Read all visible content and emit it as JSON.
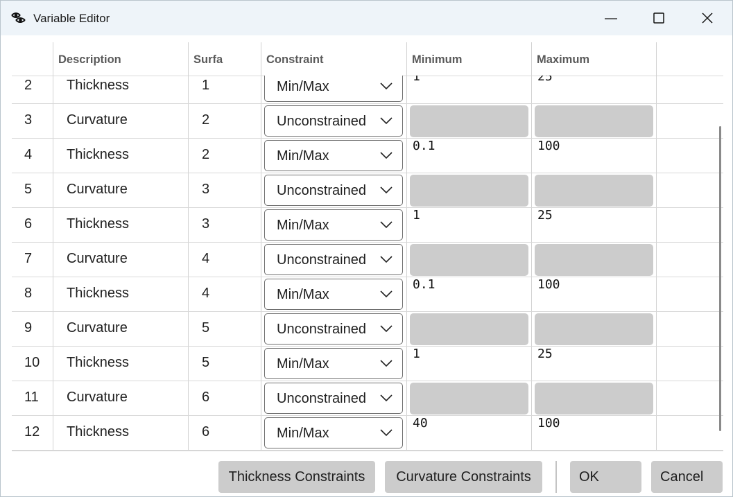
{
  "window": {
    "title": "Variable Editor",
    "controls": {
      "minimize": "minimize-icon",
      "maximize": "maximize-icon",
      "close": "close-icon"
    }
  },
  "table": {
    "columns": [
      "",
      "Description",
      "Surfa",
      "Constraint",
      "Minimum",
      "Maximum"
    ],
    "rows": [
      {
        "num": "2",
        "description": "Thickness",
        "surface": "1",
        "constraint": "Min/Max",
        "min": "1",
        "max": "25",
        "disabled": false
      },
      {
        "num": "3",
        "description": "Curvature",
        "surface": "2",
        "constraint": "Unconstrained",
        "min": "",
        "max": "",
        "disabled": true
      },
      {
        "num": "4",
        "description": "Thickness",
        "surface": "2",
        "constraint": "Min/Max",
        "min": "0.1",
        "max": "100",
        "disabled": false
      },
      {
        "num": "5",
        "description": "Curvature",
        "surface": "3",
        "constraint": "Unconstrained",
        "min": "",
        "max": "",
        "disabled": true
      },
      {
        "num": "6",
        "description": "Thickness",
        "surface": "3",
        "constraint": "Min/Max",
        "min": "1",
        "max": "25",
        "disabled": false
      },
      {
        "num": "7",
        "description": "Curvature",
        "surface": "4",
        "constraint": "Unconstrained",
        "min": "",
        "max": "",
        "disabled": true
      },
      {
        "num": "8",
        "description": "Thickness",
        "surface": "4",
        "constraint": "Min/Max",
        "min": "0.1",
        "max": "100",
        "disabled": false
      },
      {
        "num": "9",
        "description": "Curvature",
        "surface": "5",
        "constraint": "Unconstrained",
        "min": "",
        "max": "",
        "disabled": true
      },
      {
        "num": "10",
        "description": "Thickness",
        "surface": "5",
        "constraint": "Min/Max",
        "min": "1",
        "max": "25",
        "disabled": false
      },
      {
        "num": "11",
        "description": "Curvature",
        "surface": "6",
        "constraint": "Unconstrained",
        "min": "",
        "max": "",
        "disabled": true
      },
      {
        "num": "12",
        "description": "Thickness",
        "surface": "6",
        "constraint": "Min/Max",
        "min": "40",
        "max": "100",
        "disabled": false
      }
    ]
  },
  "buttons": {
    "thickness": "Thickness Constraints",
    "curvature": "Curvature Constraints",
    "ok": "OK",
    "cancel": "Cancel"
  },
  "colors": {
    "titlebar": "#eef4f9",
    "button_bg": "#cccccc",
    "disabled_field": "#cccccc",
    "header_text": "#5a5a5a"
  }
}
